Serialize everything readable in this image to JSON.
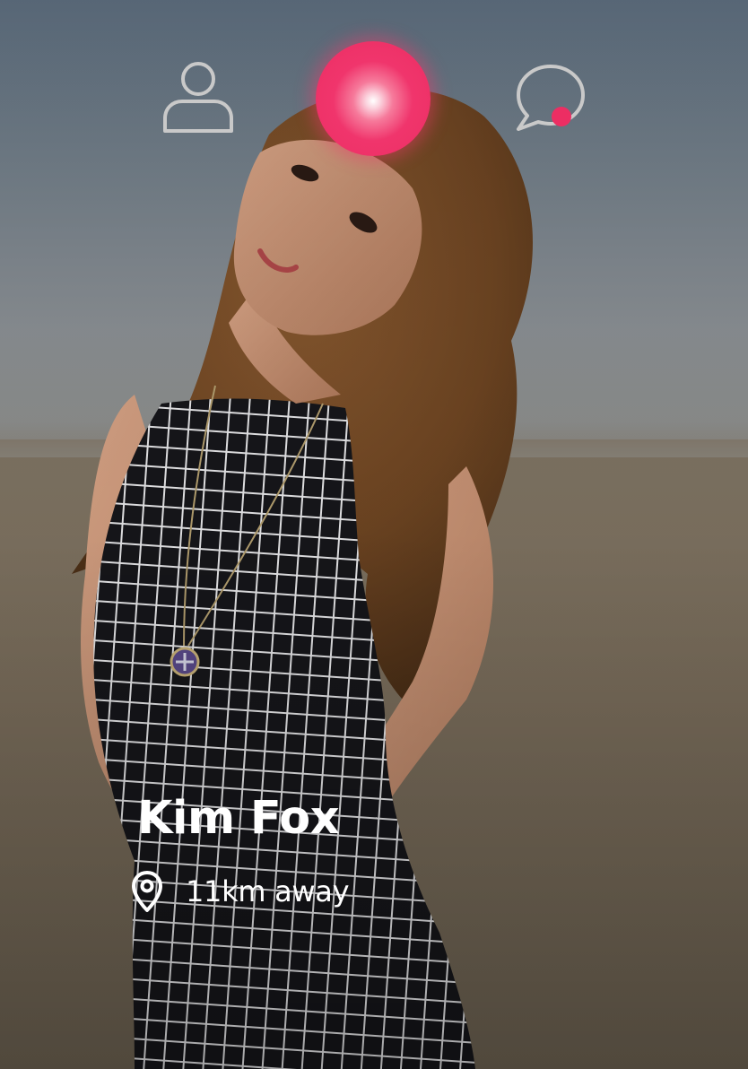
{
  "profile": {
    "name": "Kim Fox",
    "distance": "11km away"
  },
  "nav": {
    "left_icon": "user-icon",
    "center_icon": "app-logo-orb",
    "right_icon": "chat-bubble-icon",
    "chat_has_notification": true
  },
  "colors": {
    "accent": "#ec2e63",
    "icon_outline": "#c9c9c9",
    "text": "#ffffff"
  }
}
